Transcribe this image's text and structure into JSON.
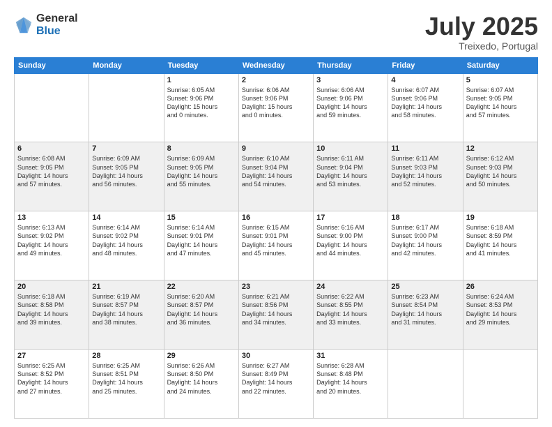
{
  "logo": {
    "general": "General",
    "blue": "Blue"
  },
  "header": {
    "month": "July 2025",
    "location": "Treixedo, Portugal"
  },
  "weekdays": [
    "Sunday",
    "Monday",
    "Tuesday",
    "Wednesday",
    "Thursday",
    "Friday",
    "Saturday"
  ],
  "weeks": [
    [
      {
        "day": "",
        "info": ""
      },
      {
        "day": "",
        "info": ""
      },
      {
        "day": "1",
        "info": "Sunrise: 6:05 AM\nSunset: 9:06 PM\nDaylight: 15 hours\nand 0 minutes."
      },
      {
        "day": "2",
        "info": "Sunrise: 6:06 AM\nSunset: 9:06 PM\nDaylight: 15 hours\nand 0 minutes."
      },
      {
        "day": "3",
        "info": "Sunrise: 6:06 AM\nSunset: 9:06 PM\nDaylight: 14 hours\nand 59 minutes."
      },
      {
        "day": "4",
        "info": "Sunrise: 6:07 AM\nSunset: 9:06 PM\nDaylight: 14 hours\nand 58 minutes."
      },
      {
        "day": "5",
        "info": "Sunrise: 6:07 AM\nSunset: 9:05 PM\nDaylight: 14 hours\nand 57 minutes."
      }
    ],
    [
      {
        "day": "6",
        "info": "Sunrise: 6:08 AM\nSunset: 9:05 PM\nDaylight: 14 hours\nand 57 minutes."
      },
      {
        "day": "7",
        "info": "Sunrise: 6:09 AM\nSunset: 9:05 PM\nDaylight: 14 hours\nand 56 minutes."
      },
      {
        "day": "8",
        "info": "Sunrise: 6:09 AM\nSunset: 9:05 PM\nDaylight: 14 hours\nand 55 minutes."
      },
      {
        "day": "9",
        "info": "Sunrise: 6:10 AM\nSunset: 9:04 PM\nDaylight: 14 hours\nand 54 minutes."
      },
      {
        "day": "10",
        "info": "Sunrise: 6:11 AM\nSunset: 9:04 PM\nDaylight: 14 hours\nand 53 minutes."
      },
      {
        "day": "11",
        "info": "Sunrise: 6:11 AM\nSunset: 9:03 PM\nDaylight: 14 hours\nand 52 minutes."
      },
      {
        "day": "12",
        "info": "Sunrise: 6:12 AM\nSunset: 9:03 PM\nDaylight: 14 hours\nand 50 minutes."
      }
    ],
    [
      {
        "day": "13",
        "info": "Sunrise: 6:13 AM\nSunset: 9:02 PM\nDaylight: 14 hours\nand 49 minutes."
      },
      {
        "day": "14",
        "info": "Sunrise: 6:14 AM\nSunset: 9:02 PM\nDaylight: 14 hours\nand 48 minutes."
      },
      {
        "day": "15",
        "info": "Sunrise: 6:14 AM\nSunset: 9:01 PM\nDaylight: 14 hours\nand 47 minutes."
      },
      {
        "day": "16",
        "info": "Sunrise: 6:15 AM\nSunset: 9:01 PM\nDaylight: 14 hours\nand 45 minutes."
      },
      {
        "day": "17",
        "info": "Sunrise: 6:16 AM\nSunset: 9:00 PM\nDaylight: 14 hours\nand 44 minutes."
      },
      {
        "day": "18",
        "info": "Sunrise: 6:17 AM\nSunset: 9:00 PM\nDaylight: 14 hours\nand 42 minutes."
      },
      {
        "day": "19",
        "info": "Sunrise: 6:18 AM\nSunset: 8:59 PM\nDaylight: 14 hours\nand 41 minutes."
      }
    ],
    [
      {
        "day": "20",
        "info": "Sunrise: 6:18 AM\nSunset: 8:58 PM\nDaylight: 14 hours\nand 39 minutes."
      },
      {
        "day": "21",
        "info": "Sunrise: 6:19 AM\nSunset: 8:57 PM\nDaylight: 14 hours\nand 38 minutes."
      },
      {
        "day": "22",
        "info": "Sunrise: 6:20 AM\nSunset: 8:57 PM\nDaylight: 14 hours\nand 36 minutes."
      },
      {
        "day": "23",
        "info": "Sunrise: 6:21 AM\nSunset: 8:56 PM\nDaylight: 14 hours\nand 34 minutes."
      },
      {
        "day": "24",
        "info": "Sunrise: 6:22 AM\nSunset: 8:55 PM\nDaylight: 14 hours\nand 33 minutes."
      },
      {
        "day": "25",
        "info": "Sunrise: 6:23 AM\nSunset: 8:54 PM\nDaylight: 14 hours\nand 31 minutes."
      },
      {
        "day": "26",
        "info": "Sunrise: 6:24 AM\nSunset: 8:53 PM\nDaylight: 14 hours\nand 29 minutes."
      }
    ],
    [
      {
        "day": "27",
        "info": "Sunrise: 6:25 AM\nSunset: 8:52 PM\nDaylight: 14 hours\nand 27 minutes."
      },
      {
        "day": "28",
        "info": "Sunrise: 6:25 AM\nSunset: 8:51 PM\nDaylight: 14 hours\nand 25 minutes."
      },
      {
        "day": "29",
        "info": "Sunrise: 6:26 AM\nSunset: 8:50 PM\nDaylight: 14 hours\nand 24 minutes."
      },
      {
        "day": "30",
        "info": "Sunrise: 6:27 AM\nSunset: 8:49 PM\nDaylight: 14 hours\nand 22 minutes."
      },
      {
        "day": "31",
        "info": "Sunrise: 6:28 AM\nSunset: 8:48 PM\nDaylight: 14 hours\nand 20 minutes."
      },
      {
        "day": "",
        "info": ""
      },
      {
        "day": "",
        "info": ""
      }
    ]
  ]
}
